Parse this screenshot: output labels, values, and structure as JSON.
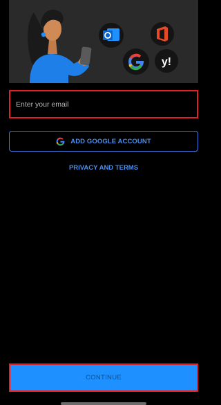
{
  "hero": {
    "illustration": "woman-holding-phone",
    "provider_icons": [
      "outlook-icon",
      "office-icon",
      "google-icon",
      "yahoo-icon"
    ]
  },
  "email": {
    "placeholder": "Enter your email",
    "value": ""
  },
  "google_button": {
    "label": "ADD GOOGLE ACCOUNT",
    "icon": "google-g-icon"
  },
  "privacy_link": {
    "label": "PRIVACY AND TERMS"
  },
  "continue_button": {
    "label": "CONTINUE",
    "state": "disabled"
  },
  "colors": {
    "background": "#000000",
    "accent_blue": "#4a8fef",
    "continue_bg": "#1e90ff",
    "highlight_red": "#e2202c",
    "hero_bg": "#2a2a2a"
  }
}
